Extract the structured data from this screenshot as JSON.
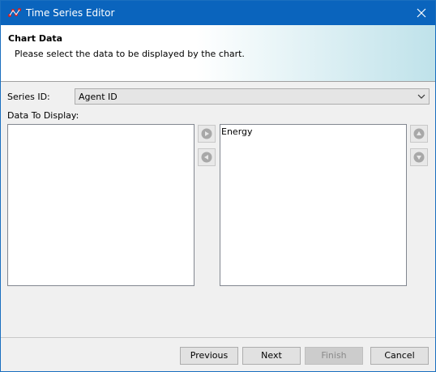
{
  "window": {
    "title": "Time Series Editor",
    "accent": "#0a64bd"
  },
  "banner": {
    "title": "Chart Data",
    "subtitle": "Please select the data to be displayed by the chart."
  },
  "form": {
    "series_label": "Series ID:",
    "series_value": "Agent ID",
    "data_label": "Data To Display:"
  },
  "lists": {
    "available": [],
    "selected": [
      "Energy"
    ]
  },
  "buttons": {
    "previous": "Previous",
    "next": "Next",
    "finish": "Finish",
    "cancel": "Cancel"
  },
  "icons": {
    "app": "time-series-app-icon",
    "close": "close-icon",
    "dropdown": "chevron-down-icon",
    "add": "arrow-right-icon",
    "remove": "arrow-left-icon",
    "up": "arrow-up-icon",
    "down": "arrow-down-icon"
  }
}
